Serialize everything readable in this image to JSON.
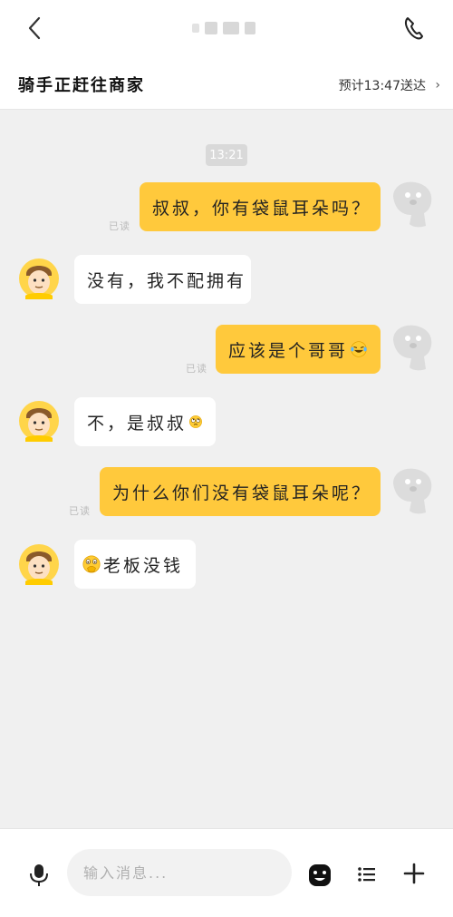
{
  "header": {
    "status_title": "骑手正赶往商家",
    "eta": "预计13:47送达",
    "eta_chevron": "›"
  },
  "chat": {
    "timestamp": "13:21",
    "messages": [
      {
        "side": "out",
        "text": "叔叔，你有袋鼠耳朵吗？",
        "read": "已读"
      },
      {
        "side": "in",
        "text": "没有，我不配拥有"
      },
      {
        "side": "out",
        "text": "应该是个哥哥",
        "read": "已读",
        "emoji": "laughing-tears"
      },
      {
        "side": "in",
        "text": "不，是叔叔",
        "emoji": "rolling-eyes"
      },
      {
        "side": "out",
        "text": "为什么你们没有袋鼠耳朵呢？",
        "read": "已读"
      },
      {
        "side": "in",
        "text": "老板没钱",
        "emoji": "shushing-face"
      }
    ]
  },
  "input": {
    "placeholder": "输入消息..."
  },
  "colors": {
    "outgoing_bubble": "#ffc93c",
    "incoming_bubble": "#ffffff",
    "chat_background": "#f0f0f0"
  }
}
